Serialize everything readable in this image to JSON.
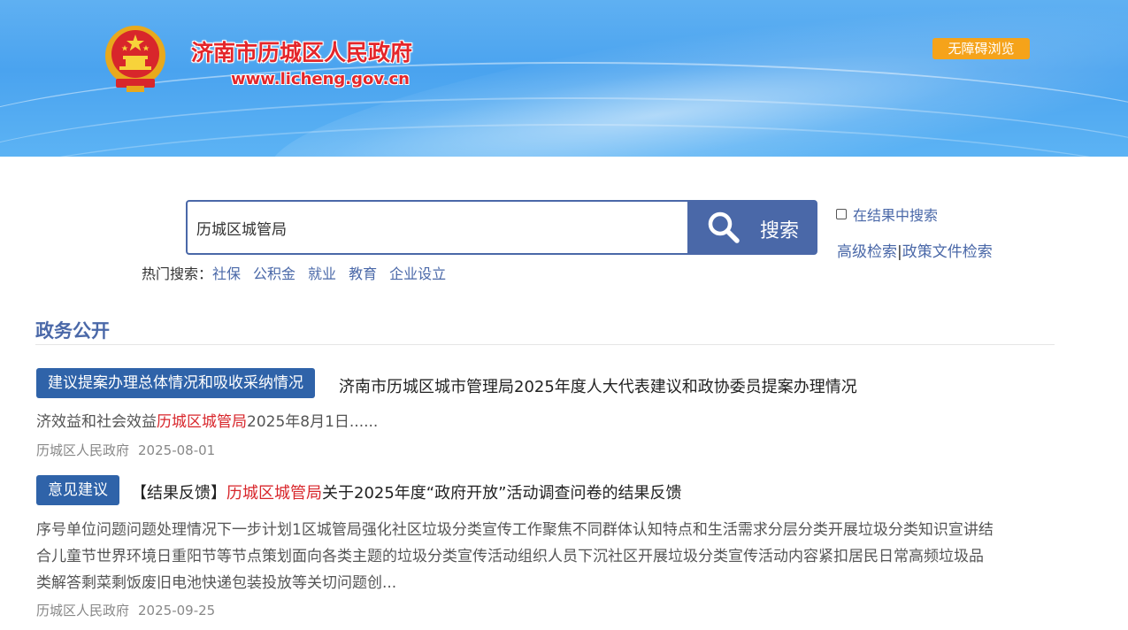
{
  "header": {
    "site_title": "济南市历城区人民政府",
    "site_url": "www.licheng.gov.cn",
    "accessibility_button": "无障碍浏览",
    "emblem_icon": "national-emblem-icon"
  },
  "search": {
    "query": "历城区城管局",
    "button_label": "搜索",
    "in_results_label": "在结果中搜索",
    "advanced_search": "高级检索",
    "separator": "|",
    "policy_search": "政策文件检索",
    "hot_label": "热门搜索：",
    "hot_terms": [
      "社保",
      "公积金",
      "就业",
      "教育",
      "企业设立"
    ]
  },
  "section": {
    "title": "政务公开"
  },
  "results": [
    {
      "tag": "建议提案办理总体情况和吸收采纳情况",
      "title_before": "济南市历城区城市管理局2025年度人大代表建议和政协委员提案办理情况",
      "title_highlight": "",
      "title_after": "",
      "snippet_before": "济效益和社会效益",
      "snippet_highlight": "历城区城管局",
      "snippet_after": "2025年8月1日......",
      "source": "历城区人民政府",
      "date": "2025-08-01"
    },
    {
      "tag": "意见建议",
      "title_before": "【结果反馈】",
      "title_highlight": "历城区城管局",
      "title_after": "关于2025年度“政府开放”活动调查问卷的结果反馈",
      "snippet_lines": [
        "序号单位问题问题处理情况下一步计划1区城管局强化社区垃圾分类宣传工作聚焦不同群体认知特点和生活需求分层分类开展垃圾分类知识宣讲结",
        "合儿童节世界环境日重阳节等节点策划面向各类主题的垃圾分类宣传活动组织人员下沉社区开展垃圾分类宣传活动内容紧扣居民日常高频垃圾品",
        "类解答剩菜剩饭废旧电池快递包装投放等关切问题创..."
      ],
      "source": "历城区人民政府",
      "date": "2025-09-25"
    }
  ],
  "colors": {
    "accent": "#4a68a8",
    "tag_bg": "#2f63a9",
    "highlight": "#d8262b",
    "a11y": "#f5a31a"
  }
}
